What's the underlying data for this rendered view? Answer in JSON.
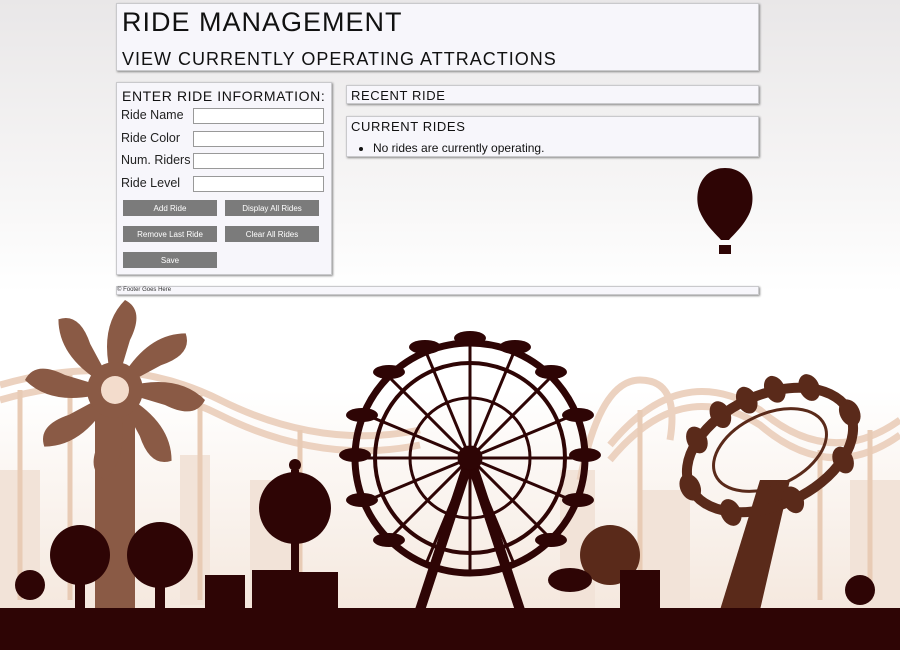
{
  "header": {
    "title": "RIDE MANAGEMENT",
    "subtitle": "VIEW CURRENTLY OPERATING ATTRACTIONS"
  },
  "form": {
    "title": "ENTER RIDE INFORMATION:",
    "fields": [
      {
        "label": "Ride Name",
        "value": ""
      },
      {
        "label": "Ride Color",
        "value": ""
      },
      {
        "label": "Num. Riders",
        "value": ""
      },
      {
        "label": "Ride Level",
        "value": ""
      }
    ],
    "buttons": {
      "add": "Add Ride",
      "display": "Display All Rides",
      "remove": "Remove Last Ride",
      "clear": "Clear All Rides",
      "save": "Save"
    }
  },
  "recent": {
    "title": "RECENT RIDE"
  },
  "current": {
    "title": "CURRENT RIDES",
    "items": [
      "No rides are currently operating."
    ]
  },
  "footer": {
    "text": "© Footer Goes Here"
  },
  "colors": {
    "silhouette": "#2e0505",
    "midtone": "#8a5a45",
    "light": "#e8cbb5",
    "button": "#7b7b7b"
  }
}
